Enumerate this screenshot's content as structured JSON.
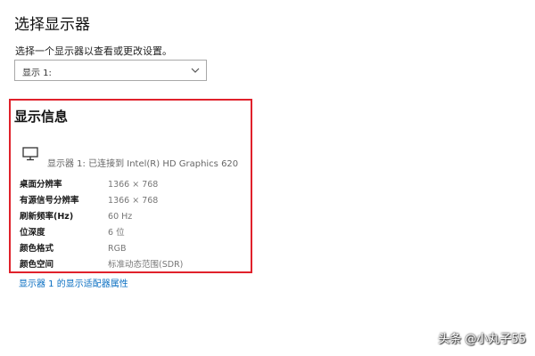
{
  "section_title": "选择显示器",
  "select_label": "选择一个显示器以查看或更改设置。",
  "dropdown": {
    "value": "显示 1:",
    "icon": "chevron-down-icon"
  },
  "info": {
    "title": "显示信息",
    "monitor_icon": "monitor-icon",
    "monitor_desc": "显示器 1: 已连接到 Intel(R) HD Graphics 620",
    "rows": [
      {
        "key": "桌面分辨率",
        "value": "1366 × 768"
      },
      {
        "key": "有源信号分辨率",
        "value": "1366 × 768"
      },
      {
        "key": "刷新频率(Hz)",
        "value": "60 Hz"
      },
      {
        "key": "位深度",
        "value": "6 位"
      },
      {
        "key": "颜色格式",
        "value": "RGB"
      },
      {
        "key": "颜色空间",
        "value": "标准动态范围(SDR)"
      }
    ],
    "highlight_color": "#e0212b"
  },
  "adapter_link": "显示器 1 的显示适配器属性",
  "link_color": "#0a6fc2",
  "watermark": "头条 @小丸子55"
}
